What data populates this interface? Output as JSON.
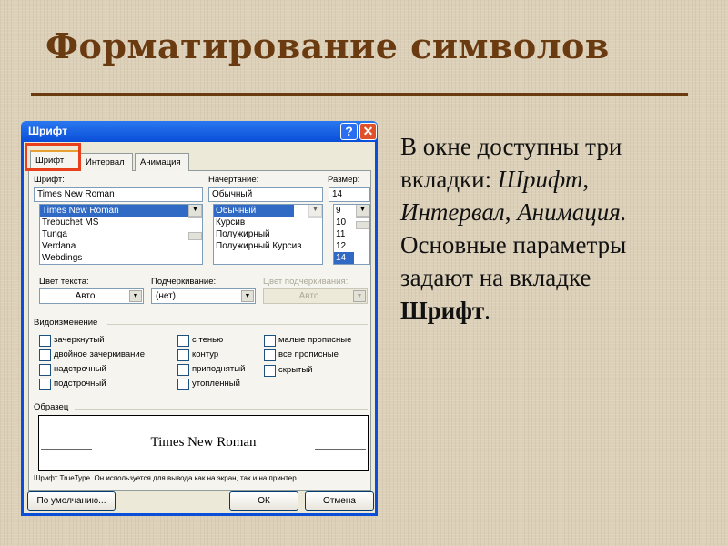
{
  "slide": {
    "title": "Форматирование символов",
    "text": {
      "l1": "В окне доступны три",
      "l2a": "вкладки: ",
      "l2b": "Шрифт",
      "l2c": ",",
      "l3a": "Интервал",
      "l3b": ", ",
      "l3c": "Анимация",
      "l3d": ".",
      "l4": "Основные параметры",
      "l5": "задают на вкладке",
      "l6a": "Шрифт",
      "l6b": "."
    }
  },
  "dialog": {
    "title": "Шрифт",
    "help": "?",
    "close": "✕",
    "tabs": [
      "Шрифт",
      "Интервал",
      "Анимация"
    ],
    "font_label": "Шрифт:",
    "font_value": "Times New Roman",
    "font_list": [
      "Times New Roman",
      "Trebuchet MS",
      "Tunga",
      "Verdana",
      "Webdings"
    ],
    "style_label": "Начертание:",
    "style_value": "Обычный",
    "style_list": [
      "Обычный",
      "Курсив",
      "Полужирный",
      "Полужирный Курсив"
    ],
    "size_label": "Размер:",
    "size_value": "14",
    "size_list": [
      "9",
      "10",
      "11",
      "12",
      "14"
    ],
    "color_label": "Цвет текста:",
    "color_value": "Авто",
    "underline_label": "Подчеркивание:",
    "underline_value": "(нет)",
    "ucolor_label": "Цвет подчеркивания:",
    "ucolor_value": "Авто",
    "effects_label": "Видоизменение",
    "effects": [
      "зачеркнутый",
      "двойное зачеркивание",
      "надстрочный",
      "подстрочный",
      "с тенью",
      "контур",
      "приподнятый",
      "утопленный",
      "малые прописные",
      "все прописные",
      "скрытый"
    ],
    "sample_label": "Образец",
    "sample_text": "Times New Roman",
    "note": "Шрифт TrueType. Он используется для вывода как на экран, так и на принтер.",
    "default_btn": "По умолчанию...",
    "ok_btn": "ОК",
    "cancel_btn": "Отмена",
    "highlight_color": "#e8401c"
  }
}
